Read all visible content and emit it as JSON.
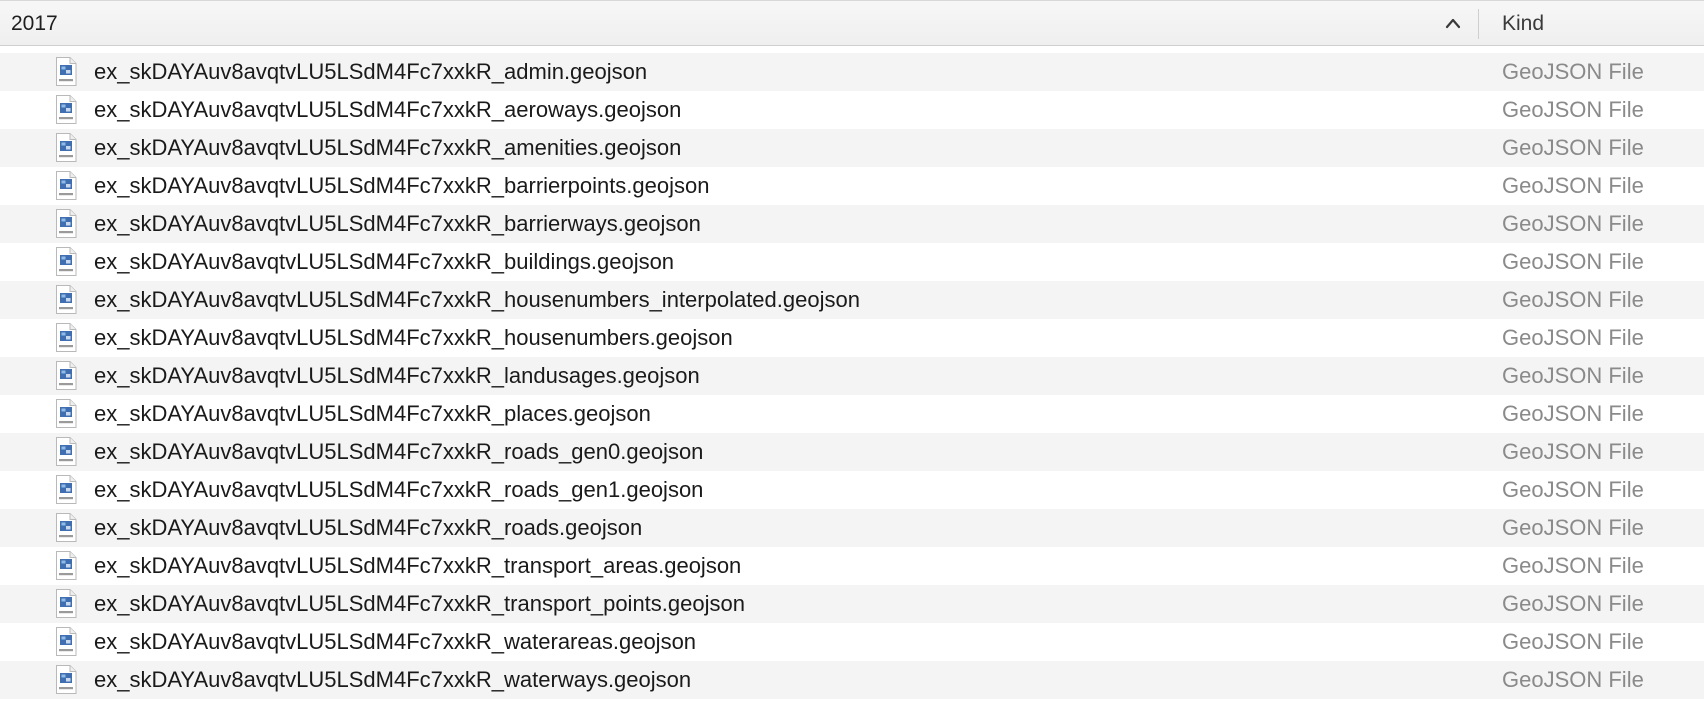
{
  "header": {
    "name_column": "2017",
    "kind_column": "Kind",
    "sort_icon": "chevron-up-icon"
  },
  "files": [
    {
      "name": "ex_skDAYAuv8avqtvLU5LSdM4Fc7xxkR_admin.geojson",
      "kind": "GeoJSON File",
      "icon": "geojson-file-icon"
    },
    {
      "name": "ex_skDAYAuv8avqtvLU5LSdM4Fc7xxkR_aeroways.geojson",
      "kind": "GeoJSON File",
      "icon": "geojson-file-icon"
    },
    {
      "name": "ex_skDAYAuv8avqtvLU5LSdM4Fc7xxkR_amenities.geojson",
      "kind": "GeoJSON File",
      "icon": "geojson-file-icon"
    },
    {
      "name": "ex_skDAYAuv8avqtvLU5LSdM4Fc7xxkR_barrierpoints.geojson",
      "kind": "GeoJSON File",
      "icon": "geojson-file-icon"
    },
    {
      "name": "ex_skDAYAuv8avqtvLU5LSdM4Fc7xxkR_barrierways.geojson",
      "kind": "GeoJSON File",
      "icon": "geojson-file-icon"
    },
    {
      "name": "ex_skDAYAuv8avqtvLU5LSdM4Fc7xxkR_buildings.geojson",
      "kind": "GeoJSON File",
      "icon": "geojson-file-icon"
    },
    {
      "name": "ex_skDAYAuv8avqtvLU5LSdM4Fc7xxkR_housenumbers_interpolated.geojson",
      "kind": "GeoJSON File",
      "icon": "geojson-file-icon"
    },
    {
      "name": "ex_skDAYAuv8avqtvLU5LSdM4Fc7xxkR_housenumbers.geojson",
      "kind": "GeoJSON File",
      "icon": "geojson-file-icon"
    },
    {
      "name": "ex_skDAYAuv8avqtvLU5LSdM4Fc7xxkR_landusages.geojson",
      "kind": "GeoJSON File",
      "icon": "geojson-file-icon"
    },
    {
      "name": "ex_skDAYAuv8avqtvLU5LSdM4Fc7xxkR_places.geojson",
      "kind": "GeoJSON File",
      "icon": "geojson-file-icon"
    },
    {
      "name": "ex_skDAYAuv8avqtvLU5LSdM4Fc7xxkR_roads_gen0.geojson",
      "kind": "GeoJSON File",
      "icon": "geojson-file-icon"
    },
    {
      "name": "ex_skDAYAuv8avqtvLU5LSdM4Fc7xxkR_roads_gen1.geojson",
      "kind": "GeoJSON File",
      "icon": "geojson-file-icon"
    },
    {
      "name": "ex_skDAYAuv8avqtvLU5LSdM4Fc7xxkR_roads.geojson",
      "kind": "GeoJSON File",
      "icon": "geojson-file-icon"
    },
    {
      "name": "ex_skDAYAuv8avqtvLU5LSdM4Fc7xxkR_transport_areas.geojson",
      "kind": "GeoJSON File",
      "icon": "geojson-file-icon"
    },
    {
      "name": "ex_skDAYAuv8avqtvLU5LSdM4Fc7xxkR_transport_points.geojson",
      "kind": "GeoJSON File",
      "icon": "geojson-file-icon"
    },
    {
      "name": "ex_skDAYAuv8avqtvLU5LSdM4Fc7xxkR_waterareas.geojson",
      "kind": "GeoJSON File",
      "icon": "geojson-file-icon"
    },
    {
      "name": "ex_skDAYAuv8avqtvLU5LSdM4Fc7xxkR_waterways.geojson",
      "kind": "GeoJSON File",
      "icon": "geojson-file-icon"
    }
  ],
  "colors": {
    "row_stripe": "#f4f4f4",
    "kind_text": "#8a8a8a",
    "name_text": "#1a1a1a"
  }
}
